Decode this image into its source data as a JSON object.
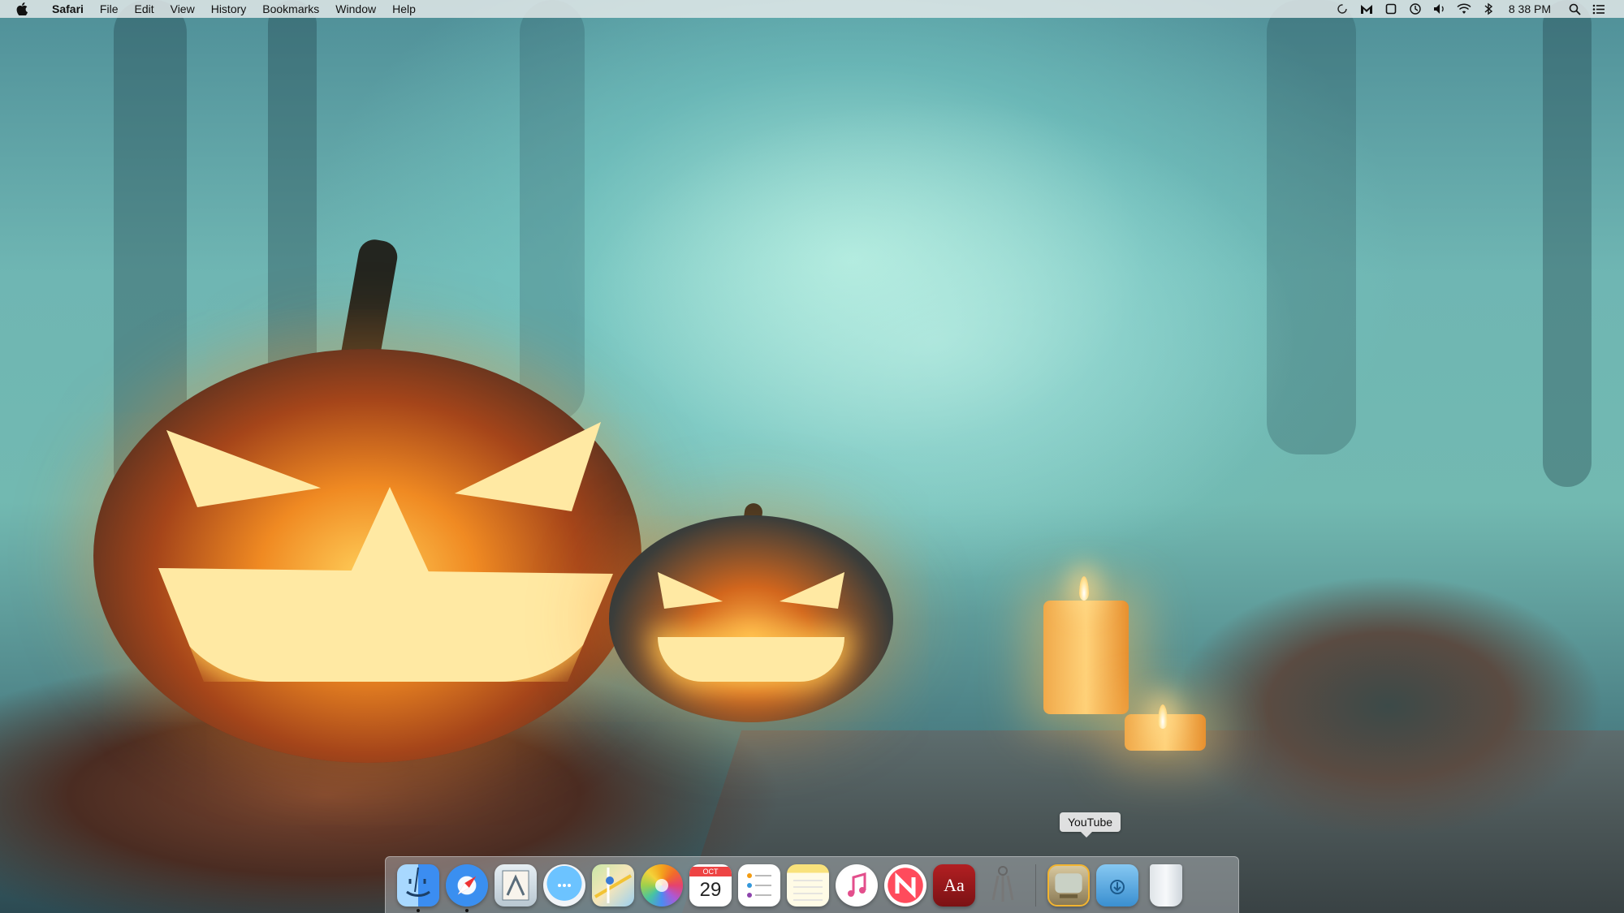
{
  "menubar": {
    "apple_icon": "apple-logo-icon",
    "app_name": "Safari",
    "menus": [
      "File",
      "Edit",
      "View",
      "History",
      "Bookmarks",
      "Window",
      "Help"
    ],
    "status_icons": [
      "sync-icon",
      "malwarebytes-icon",
      "screen-icon",
      "time-machine-icon",
      "volume-icon",
      "wifi-icon",
      "bluetooth-icon"
    ],
    "clock": "8 38 PM",
    "right_icons": [
      "spotlight-search-icon",
      "notification-center-icon"
    ]
  },
  "desktop": {
    "wallpaper": "halloween-jack-o-lanterns-misty-forest"
  },
  "dock": {
    "items": [
      {
        "name": "Finder",
        "icon": "finder-icon",
        "running": true
      },
      {
        "name": "Safari",
        "icon": "safari-icon",
        "running": true
      },
      {
        "name": "Mail",
        "icon": "mail-icon",
        "running": false
      },
      {
        "name": "Messages",
        "icon": "messages-icon",
        "running": false
      },
      {
        "name": "Maps",
        "icon": "maps-icon",
        "running": false
      },
      {
        "name": "Photos",
        "icon": "photos-icon",
        "running": false
      },
      {
        "name": "Calendar",
        "icon": "calendar-icon",
        "running": false,
        "month": "OCT",
        "day": "29"
      },
      {
        "name": "Reminders",
        "icon": "reminders-icon",
        "running": false
      },
      {
        "name": "Notes",
        "icon": "notes-icon",
        "running": false
      },
      {
        "name": "iTunes",
        "icon": "itunes-icon",
        "running": false
      },
      {
        "name": "News",
        "icon": "news-icon",
        "running": false
      },
      {
        "name": "Dictionary",
        "icon": "dictionary-icon",
        "running": false,
        "glyph": "Aa"
      },
      {
        "name": "Keychain Access",
        "icon": "keychain-icon",
        "running": false
      },
      {
        "name": "YouTube",
        "icon": "youtube-icon",
        "running": false
      },
      {
        "name": "Downloads",
        "icon": "downloads-folder-icon",
        "running": false
      },
      {
        "name": "Trash",
        "icon": "trash-icon",
        "running": false
      }
    ],
    "tooltip": "YouTube"
  },
  "colors": {
    "menubar_bg": "#e8ecec",
    "running_dot": "#111111",
    "tooltip_bg": "#ebebeb"
  }
}
